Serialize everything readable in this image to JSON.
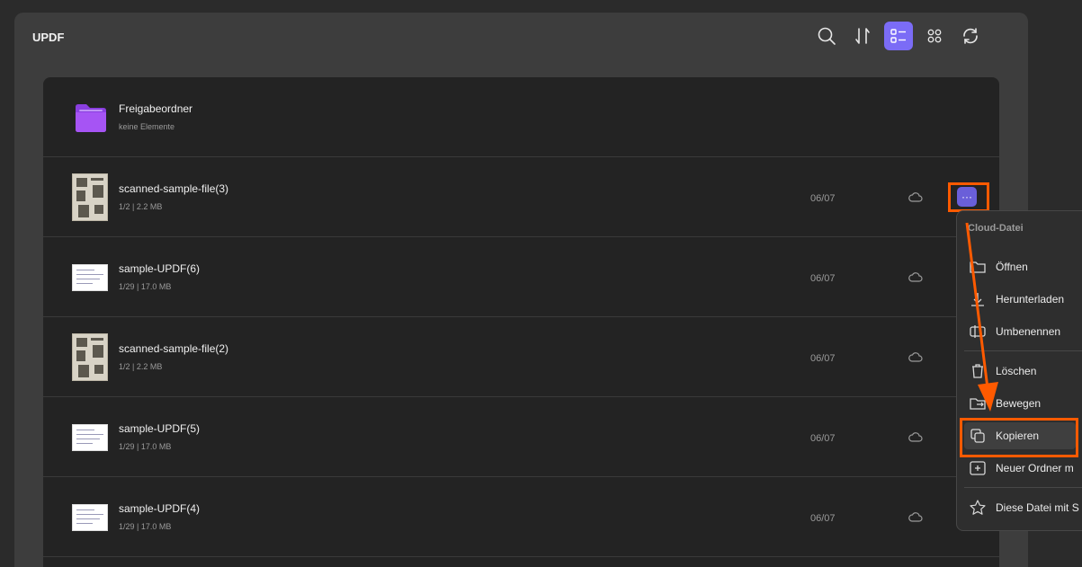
{
  "app": {
    "title": "UPDF"
  },
  "toolbar": {
    "buttons": [
      {
        "icon": "search-icon"
      },
      {
        "icon": "sort-icon"
      },
      {
        "icon": "list-view-icon",
        "active": true
      },
      {
        "icon": "grid-view-icon"
      },
      {
        "icon": "refresh-icon"
      }
    ]
  },
  "folder": {
    "name": "Freigabeordner",
    "meta": "keine Elemente",
    "icon": "folder-icon"
  },
  "files": [
    {
      "name": "scanned-sample-file(3)",
      "meta": "1/2 | 2.2 MB",
      "date": "06/07",
      "thumb": "scan"
    },
    {
      "name": "sample-UPDF(6)",
      "meta": "1/29 | 17.0 MB",
      "date": "06/07",
      "thumb": "doc"
    },
    {
      "name": "scanned-sample-file(2)",
      "meta": "1/2 | 2.2 MB",
      "date": "06/07",
      "thumb": "scan"
    },
    {
      "name": "sample-UPDF(5)",
      "meta": "1/29 | 17.0 MB",
      "date": "06/07",
      "thumb": "doc"
    },
    {
      "name": "sample-UPDF(4)",
      "meta": "1/29 | 17.0 MB",
      "date": "06/07",
      "thumb": "doc"
    }
  ],
  "more_button": {
    "label": "···"
  },
  "menu": {
    "header": "Cloud-Datei",
    "items": [
      {
        "label": "Öffnen",
        "icon": "folder-open-icon"
      },
      {
        "label": "Herunterladen",
        "icon": "download-icon"
      },
      {
        "label": "Umbenennen",
        "icon": "rename-icon"
      },
      {
        "label": "Löschen",
        "icon": "trash-icon"
      },
      {
        "label": "Bewegen",
        "icon": "move-icon"
      },
      {
        "label": "Kopieren",
        "icon": "copy-icon",
        "selected": true
      },
      {
        "label": "Neuer Ordner m",
        "icon": "new-folder-icon"
      },
      {
        "label": "Diese Datei mit S",
        "icon": "star-icon"
      }
    ]
  },
  "colors": {
    "accent": "#7b6cf6",
    "highlight": "#ff5a00",
    "background": "#2b2b2b",
    "panel": "#3d3d3d",
    "list": "#232323"
  }
}
